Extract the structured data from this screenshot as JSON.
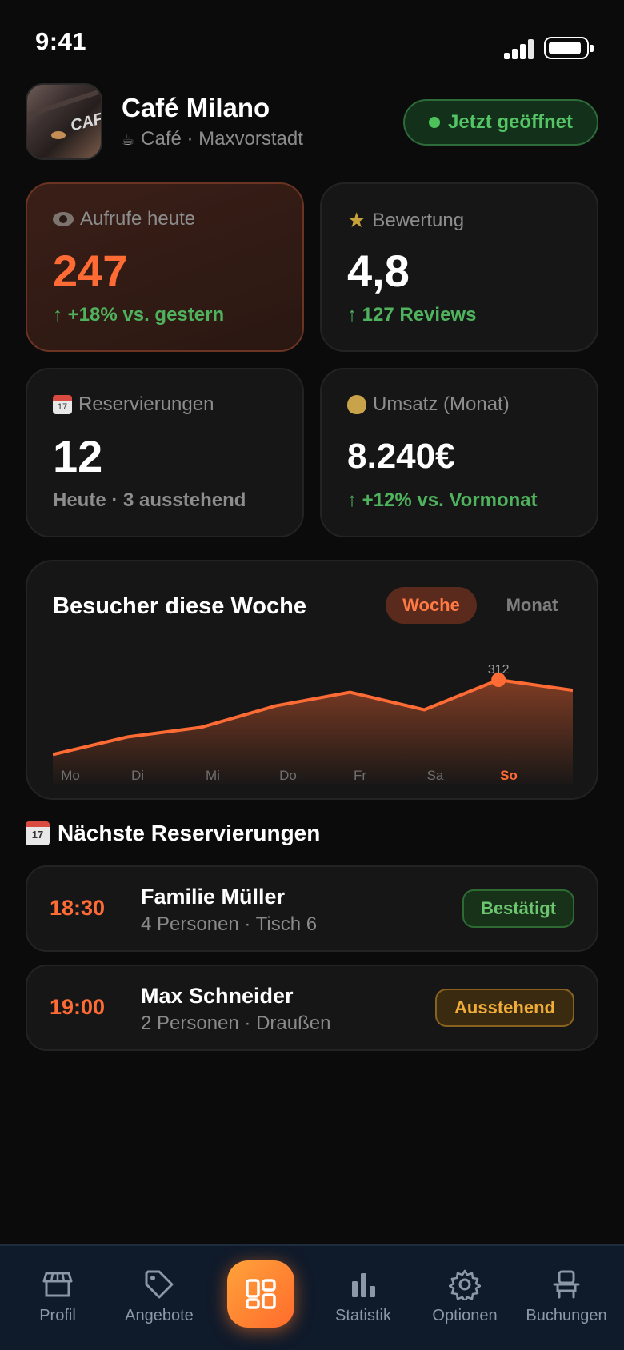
{
  "status_bar": {
    "time": "9:41"
  },
  "header": {
    "avatar_sign": "CAF",
    "name": "Café Milano",
    "subtitle": "Café · Maxvorstadt",
    "open_status": "Jetzt geöffnet"
  },
  "stats": {
    "views": {
      "label": "Aufrufe heute",
      "value": "247",
      "sub": "↑ +18% vs. gestern",
      "icon": "eye-icon"
    },
    "rating": {
      "label": "Bewertung",
      "value": "4,8",
      "sub": "↑ 127 Reviews",
      "icon": "star-icon"
    },
    "reservations": {
      "label": "Reservierungen",
      "value": "12",
      "sub": "Heute · 3 ausstehend",
      "icon": "calendar-icon"
    },
    "revenue": {
      "label": "Umsatz (Monat)",
      "value": "8.240€",
      "sub": "↑ +12% vs. Vormonat",
      "icon": "money-bag-icon"
    }
  },
  "chart": {
    "title": "Besucher diese Woche",
    "toggle_week": "Woche",
    "toggle_month": "Monat",
    "peak_label": "312"
  },
  "chart_data": {
    "type": "area",
    "categories": [
      "Mo",
      "Di",
      "Mi",
      "Do",
      "Fr",
      "Sa",
      "So"
    ],
    "values": [
      120,
      165,
      190,
      245,
      280,
      235,
      312,
      285
    ],
    "title": "Besucher diese Woche",
    "highlight_category": "So",
    "annotation": "312",
    "accent_color": "#ff6b35"
  },
  "reservations_section": {
    "title": "Nächste Reservierungen",
    "items": [
      {
        "time": "18:30",
        "name": "Familie Müller",
        "detail": "4 Personen · Tisch 6",
        "status": "Bestätigt"
      },
      {
        "time": "19:00",
        "name": "Max Schneider",
        "detail": "2 Personen · Draußen",
        "status": "Ausstehend"
      }
    ]
  },
  "tab_bar": {
    "tabs": [
      {
        "label": "Profil",
        "icon": "store-icon"
      },
      {
        "label": "Angebote",
        "icon": "tag-icon"
      },
      {
        "label": "",
        "icon": "dashboard-icon"
      },
      {
        "label": "Statistik",
        "icon": "bar-chart-icon"
      },
      {
        "label": "Optionen",
        "icon": "gear-icon"
      },
      {
        "label": "Buchungen",
        "icon": "chair-icon"
      }
    ]
  },
  "colors": {
    "accent": "#ff6b35",
    "success": "#4cc35a",
    "warning": "#f0ad3a",
    "background": "#0b0b0b"
  }
}
